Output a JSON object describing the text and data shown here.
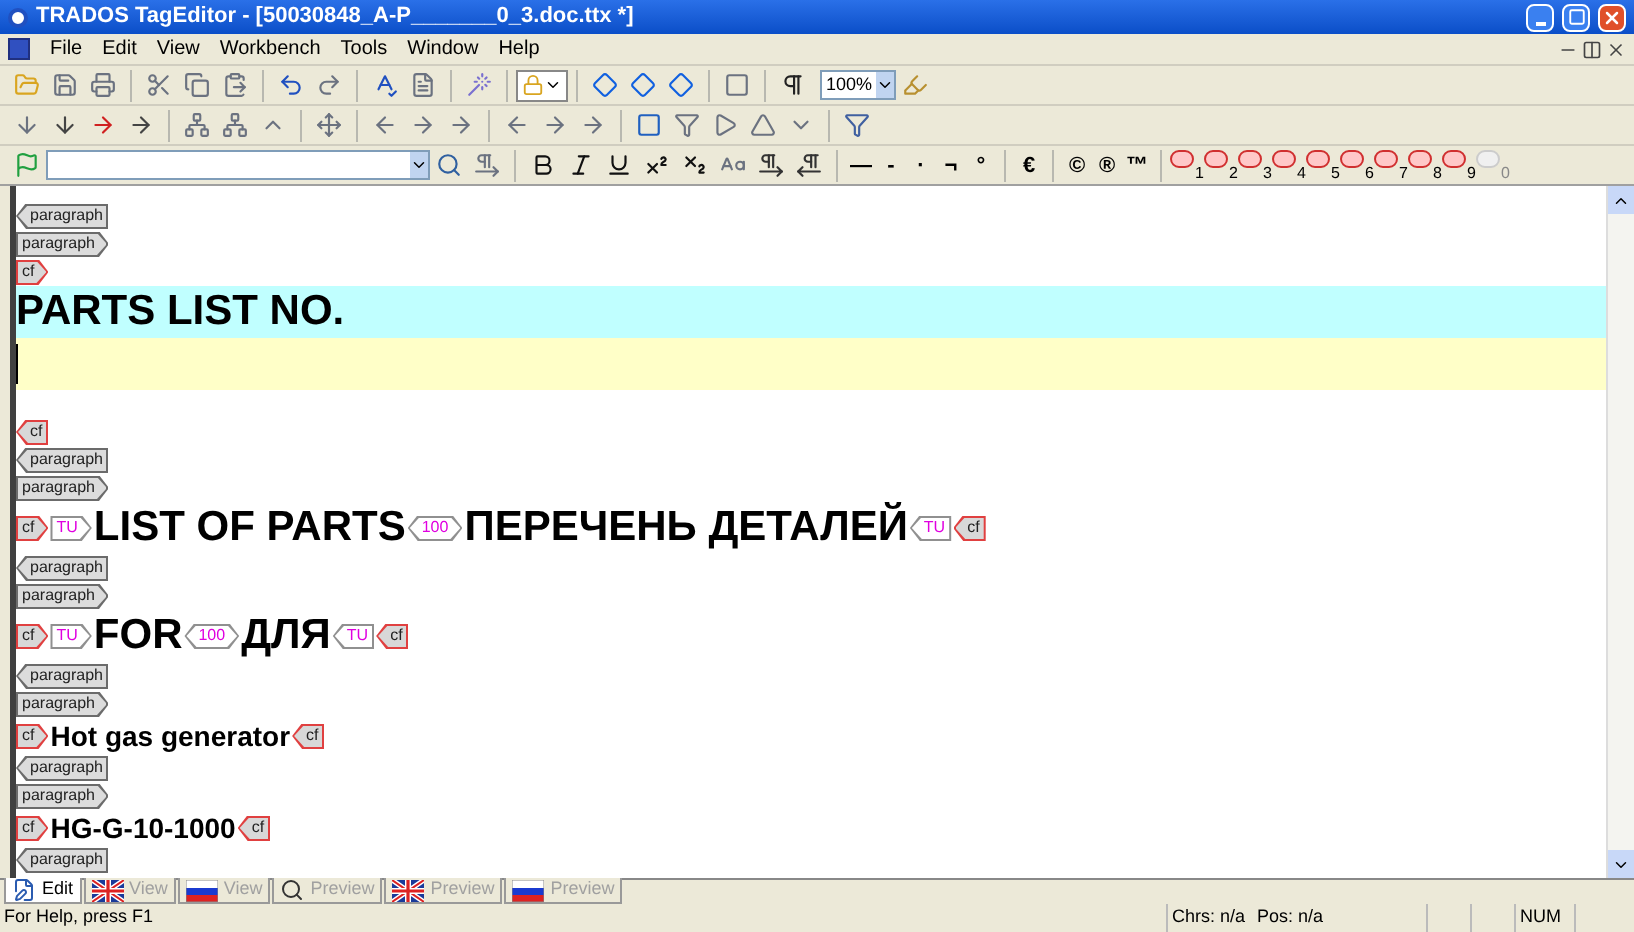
{
  "window": {
    "title": "TRADOS TagEditor - [50030848_A-P_______0_3.doc.ttx *]"
  },
  "menu": {
    "items": [
      "File",
      "Edit",
      "View",
      "Workbench",
      "Tools",
      "Window",
      "Help"
    ]
  },
  "toolbar": {
    "zoom": "100%",
    "symbol_groups": [
      [
        "—",
        "-",
        "·",
        "¬",
        "°"
      ],
      [
        "€"
      ],
      [
        "©",
        "®",
        "™"
      ]
    ],
    "tag_buttons": [
      {
        "label": "1",
        "disabled": false
      },
      {
        "label": "2",
        "disabled": false
      },
      {
        "label": "3",
        "disabled": false
      },
      {
        "label": "4",
        "disabled": false
      },
      {
        "label": "5",
        "disabled": false
      },
      {
        "label": "6",
        "disabled": false
      },
      {
        "label": "7",
        "disabled": false
      },
      {
        "label": "8",
        "disabled": false
      },
      {
        "label": "9",
        "disabled": false
      },
      {
        "label": "0",
        "disabled": true
      }
    ]
  },
  "document": {
    "lines": [
      {
        "kind": "tags",
        "items": [
          {
            "kind": "paraclose",
            "label": "paragraph"
          }
        ]
      },
      {
        "kind": "tags",
        "items": [
          {
            "kind": "paraopen",
            "label": "paragraph"
          }
        ]
      },
      {
        "kind": "tags",
        "items": [
          {
            "kind": "cfopen",
            "label": "cf"
          }
        ]
      },
      {
        "kind": "source",
        "items": [
          {
            "kind": "text",
            "text": "PARTS LIST NO."
          }
        ]
      },
      {
        "kind": "target"
      },
      {
        "kind": "tags",
        "items": [
          {
            "kind": "cfclose",
            "label": "cf"
          }
        ]
      },
      {
        "kind": "tags",
        "items": [
          {
            "kind": "paraclose",
            "label": "paragraph"
          }
        ]
      },
      {
        "kind": "tags",
        "items": [
          {
            "kind": "paraopen",
            "label": "paragraph"
          }
        ]
      },
      {
        "kind": "large",
        "items": [
          {
            "kind": "cfopen",
            "label": "cf"
          },
          {
            "kind": "tuopen",
            "label": "TU"
          },
          {
            "kind": "text",
            "text": "LIST OF PARTS"
          },
          {
            "kind": "match",
            "label": "100"
          },
          {
            "kind": "text",
            "text": "ПЕРЕЧЕНЬ ДЕТАЛЕЙ"
          },
          {
            "kind": "tuclose",
            "label": "TU"
          },
          {
            "kind": "cfclose",
            "label": "cf"
          }
        ]
      },
      {
        "kind": "tags",
        "items": [
          {
            "kind": "paraclose",
            "label": "paragraph"
          }
        ]
      },
      {
        "kind": "tags",
        "items": [
          {
            "kind": "paraopen",
            "label": "paragraph"
          }
        ]
      },
      {
        "kind": "large",
        "items": [
          {
            "kind": "cfopen",
            "label": "cf"
          },
          {
            "kind": "tuopen",
            "label": "TU"
          },
          {
            "kind": "text",
            "text": "FOR"
          },
          {
            "kind": "match",
            "label": "100"
          },
          {
            "kind": "text",
            "text": "ДЛЯ"
          },
          {
            "kind": "tuclose",
            "label": "TU"
          },
          {
            "kind": "cfclose",
            "label": "cf"
          }
        ]
      },
      {
        "kind": "tags",
        "items": [
          {
            "kind": "paraclose",
            "label": "paragraph"
          }
        ]
      },
      {
        "kind": "tags",
        "items": [
          {
            "kind": "paraopen",
            "label": "paragraph"
          }
        ]
      },
      {
        "kind": "medium",
        "items": [
          {
            "kind": "cfopen",
            "label": "cf"
          },
          {
            "kind": "text",
            "text": "Hot gas generator"
          },
          {
            "kind": "cfclose",
            "label": "cf"
          }
        ]
      },
      {
        "kind": "tags",
        "items": [
          {
            "kind": "paraclose",
            "label": "paragraph"
          }
        ]
      },
      {
        "kind": "tags",
        "items": [
          {
            "kind": "paraopen",
            "label": "paragraph"
          }
        ]
      },
      {
        "kind": "medium",
        "items": [
          {
            "kind": "cfopen",
            "label": "cf"
          },
          {
            "kind": "text",
            "text": "HG-G-10-1000"
          },
          {
            "kind": "cfclose",
            "label": "cf"
          }
        ]
      },
      {
        "kind": "tags",
        "items": [
          {
            "kind": "paraclose",
            "label": "paragraph"
          }
        ]
      }
    ]
  },
  "view_tabs": [
    {
      "label": "Edit",
      "selected": true
    },
    {
      "label": "View",
      "selected": false
    },
    {
      "label": "View",
      "selected": false
    },
    {
      "label": "Preview",
      "selected": false
    },
    {
      "label": "Preview",
      "selected": false
    },
    {
      "label": "Preview",
      "selected": false
    }
  ],
  "status_bar": {
    "help": "For Help, press F1",
    "chars": "Chrs: n/a",
    "pos": "Pos: n/a",
    "num": "NUM"
  }
}
